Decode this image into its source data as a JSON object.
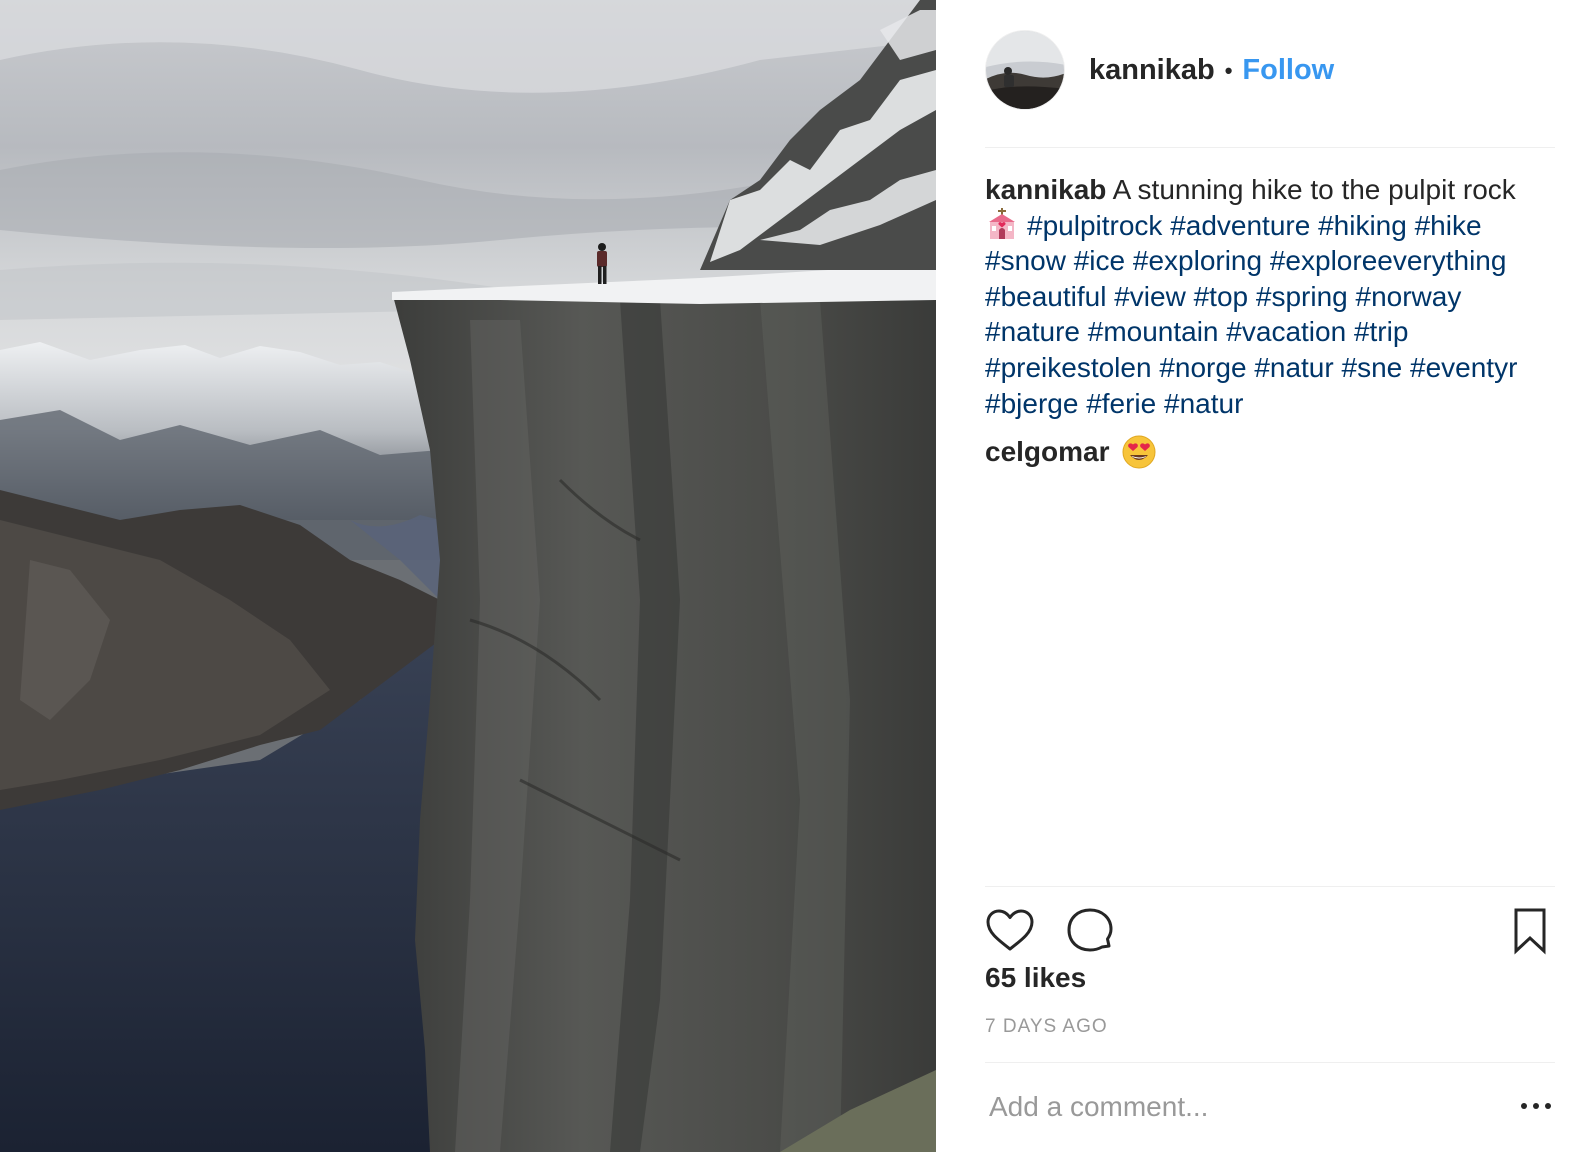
{
  "post": {
    "photo_alt": "Hiker standing on the edge of Pulpit Rock above a fjord"
  },
  "header": {
    "username": "kannikab",
    "separator": "•",
    "follow_label": "Follow"
  },
  "caption": {
    "username": "kannikab",
    "text": "A stunning hike to the pulpit rock",
    "emoji": "church-emoji",
    "hashtags": [
      "#pulpitrock",
      "#adventure",
      "#hiking",
      "#hike",
      "#snow",
      "#ice",
      "#exploring",
      "#exploreeverything",
      "#beautiful",
      "#view",
      "#top",
      "#spring",
      "#norway",
      "#nature",
      "#mountain",
      "#vacation",
      "#trip",
      "#preikestolen",
      "#norge",
      "#natur",
      "#sne",
      "#eventyr",
      "#bjerge",
      "#ferie",
      "#natur"
    ]
  },
  "comments": [
    {
      "username": "celgomar",
      "emoji": "heart-eyes-emoji"
    }
  ],
  "actions": {
    "like_icon": "heart-icon",
    "comment_icon": "speech-bubble-icon",
    "save_icon": "bookmark-icon"
  },
  "likes": "65 likes",
  "timestamp": "7 DAYS AGO",
  "add_comment": {
    "placeholder": "Add a comment...",
    "more_icon": "ellipsis-icon"
  },
  "colors": {
    "link": "#3897f0",
    "hashtag": "#003569",
    "text": "#262626",
    "muted": "#999999",
    "divider": "#efefef"
  }
}
